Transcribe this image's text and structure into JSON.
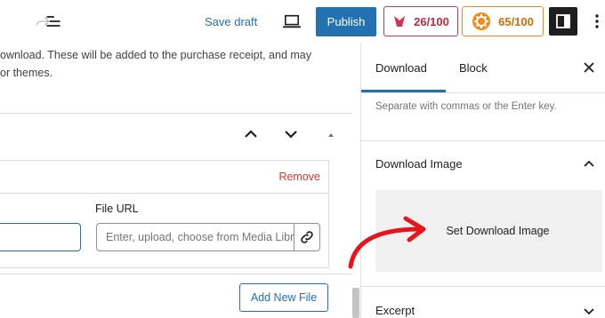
{
  "toolbar": {
    "save_draft": "Save draft",
    "publish": "Publish",
    "seo_score": "26/100",
    "readability_score": "65/100"
  },
  "editor": {
    "description": "ownload. These will be added to the purchase receipt, and may be used by some extensions or themes.",
    "description_line1": "ownload. These will be added to the purchase receipt, and may",
    "description_line2": "or themes.",
    "remove": "Remove",
    "file_url_label": "File URL",
    "file_url_placeholder": "Enter, upload, choose from Media Library",
    "add_new_file": "Add New File"
  },
  "sidebar": {
    "tabs": [
      {
        "label": "Download",
        "active": true
      },
      {
        "label": "Block",
        "active": false
      }
    ],
    "help_text": "Separate with commas or the Enter key.",
    "download_image_title": "Download Image",
    "set_image": "Set Download Image",
    "excerpt_title": "Excerpt"
  },
  "colors": {
    "accent": "#2271b1",
    "remove": "#d63638",
    "seo_badge": "#d7324f",
    "readability_badge": "#f28a1a",
    "annotation_arrow": "#e8141c"
  }
}
